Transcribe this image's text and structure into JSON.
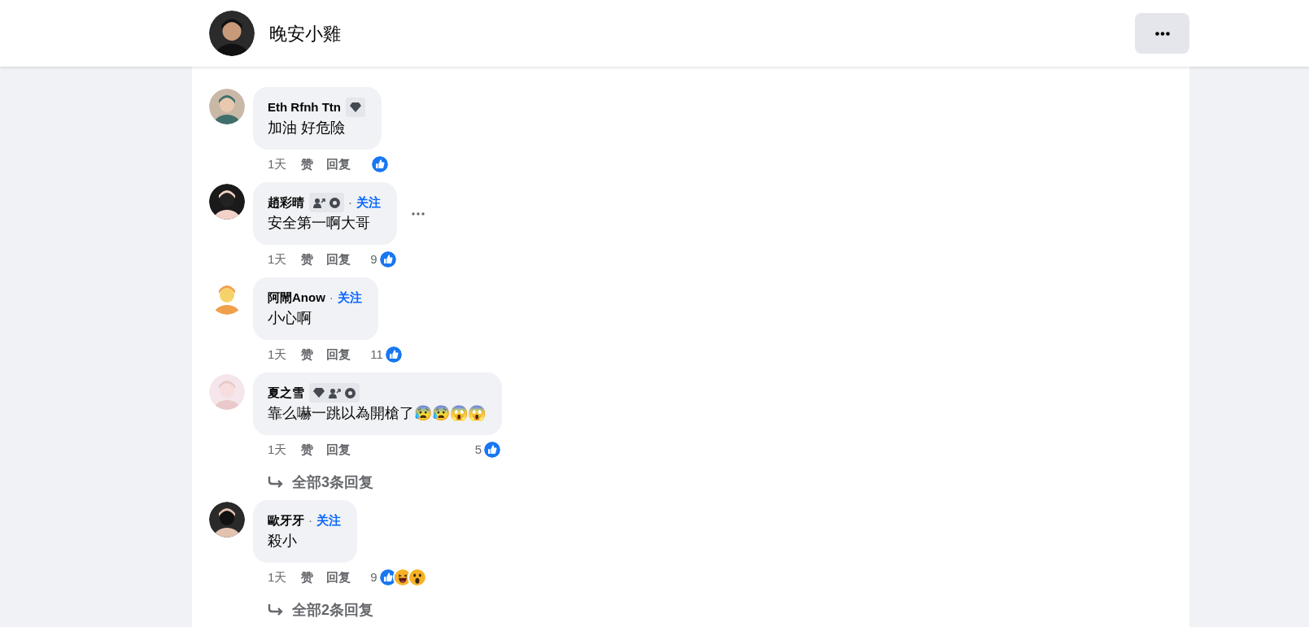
{
  "header": {
    "title": "晚安小雞"
  },
  "comments": [
    {
      "name": "Eth Rfnh Ttn",
      "badges": [
        {
          "kind": "diamond"
        }
      ],
      "text": "加油 好危險",
      "more": false,
      "time": "1天",
      "like": "赞",
      "reply": "回复",
      "reactions": [
        {
          "kind": "like"
        }
      ]
    },
    {
      "name": "趙彩晴",
      "badges": [
        {
          "kind": "person"
        },
        {
          "kind": "level"
        }
      ],
      "separator": "·",
      "follow": "关注",
      "text": "安全第一啊大哥",
      "more": true,
      "time": "1天",
      "like": "赞",
      "reply": "回复",
      "count": "9",
      "reactions": [
        {
          "kind": "like"
        }
      ]
    },
    {
      "name": "阿閙Anow",
      "separator": "·",
      "follow": "关注",
      "text": "小心啊",
      "more": false,
      "time": "1天",
      "like": "赞",
      "reply": "回复",
      "count": "11",
      "reactions": [
        {
          "kind": "like"
        }
      ]
    },
    {
      "name": "夏之雪",
      "badges": [
        {
          "kind": "diamond"
        },
        {
          "kind": "person"
        },
        {
          "kind": "level"
        }
      ],
      "text": "靠么嚇一跳以為開槍了😰😰😱😱",
      "more": false,
      "time": "1天",
      "like": "赞",
      "reply": "回复",
      "count": "5",
      "reactions": [
        {
          "kind": "like"
        }
      ],
      "replies": "全部3条回复"
    },
    {
      "name": "歐牙牙",
      "separator": "·",
      "follow": "关注",
      "text": "殺小",
      "more": false,
      "time": "1天",
      "like": "赞",
      "reply": "回复",
      "count": "9",
      "reactions": [
        {
          "kind": "like"
        },
        {
          "kind": "haha"
        },
        {
          "kind": "wow"
        }
      ],
      "replies": "全部2条回复"
    }
  ]
}
